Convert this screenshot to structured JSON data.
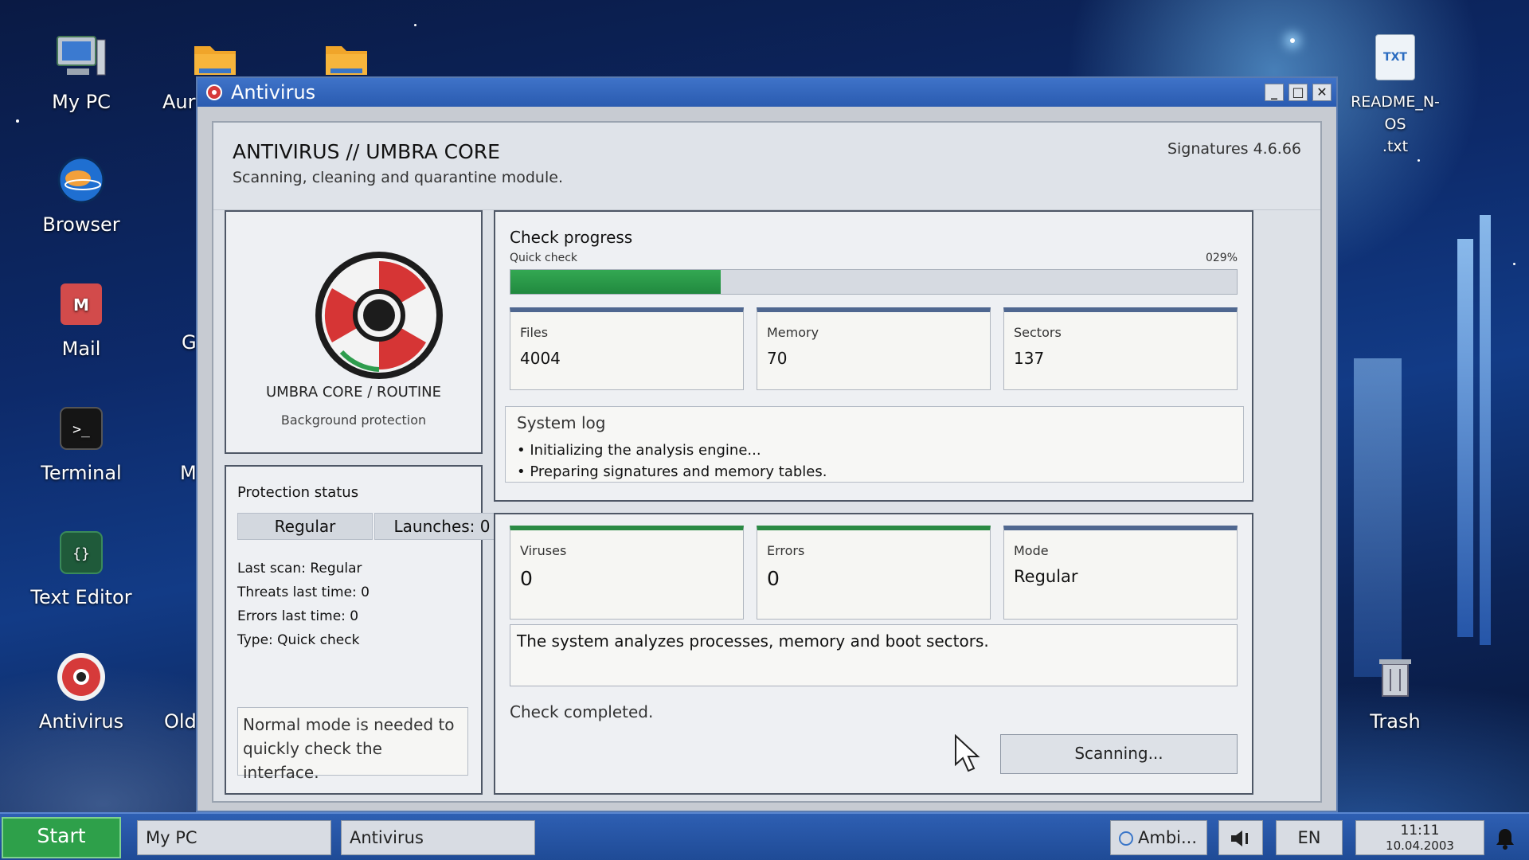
{
  "desktop": {
    "icons": [
      {
        "label": "My PC",
        "icon": "computer-icon"
      },
      {
        "label": "Browser",
        "icon": "globe-icon"
      },
      {
        "label": "Mail",
        "icon": "mail-icon"
      },
      {
        "label": "Terminal",
        "icon": "terminal-icon"
      },
      {
        "label": "Text Editor",
        "icon": "code-braces-icon"
      },
      {
        "label": "Antivirus",
        "icon": "lifebuoy-icon"
      },
      {
        "label": "Aur",
        "icon": "folder-icon"
      },
      {
        "label": "Old",
        "icon": "folder-icon"
      },
      {
        "label": "README_N-OS\n.txt",
        "icon": "txt-file-icon",
        "badge": "TXT"
      },
      {
        "label": "Trash",
        "icon": "trash-icon"
      }
    ],
    "partial_letters": [
      "G",
      "M"
    ]
  },
  "window": {
    "title": "Antivirus",
    "controls": {
      "minimize": "_",
      "maximize": "□",
      "close": "✕"
    },
    "header": {
      "title": "ANTIVIRUS // UMBRA CORE",
      "subtitle": "Scanning, cleaning and quarantine module.",
      "signatures": "Signatures 4.6.66"
    },
    "logo_panel": {
      "name": "UMBRA CORE / ROUTINE",
      "sub": "Background protection"
    },
    "status": {
      "title": "Protection status",
      "mode": "Regular",
      "launches": "Launches: 0",
      "last_scan": "Last scan: Regular",
      "threats": "Threats last time: 0",
      "errors": "Errors last time: 0",
      "type": "Type: Quick check",
      "note": "Normal mode is needed to quickly check the interface."
    },
    "progress": {
      "title": "Check progress",
      "kind": "Quick check",
      "percent_text": "029%",
      "percent": 29,
      "cards": [
        {
          "label": "Files",
          "value": "4004"
        },
        {
          "label": "Memory",
          "value": "70"
        },
        {
          "label": "Sectors",
          "value": "137"
        }
      ],
      "log_title": "System log",
      "log": [
        "• Initializing the analysis engine...",
        "• Preparing signatures and memory tables."
      ]
    },
    "results": {
      "cards": [
        {
          "label": "Viruses",
          "value": "0"
        },
        {
          "label": "Errors",
          "value": "0"
        },
        {
          "label": "Mode",
          "value": "Regular"
        }
      ],
      "description": "The system analyzes processes, memory and boot sectors.",
      "done": "Check completed.",
      "scan_button": "Scanning..."
    }
  },
  "taskbar": {
    "start": "Start",
    "tasks": [
      "My PC",
      "Antivirus"
    ],
    "ambient": "Ambi...",
    "lang": "EN",
    "time": "11:11",
    "date": "10.04.2003"
  },
  "colors": {
    "accent": "#2a5bb0",
    "progress": "#2ea04a",
    "card_top": "#4f6790",
    "card_ok": "#2a8a44"
  }
}
